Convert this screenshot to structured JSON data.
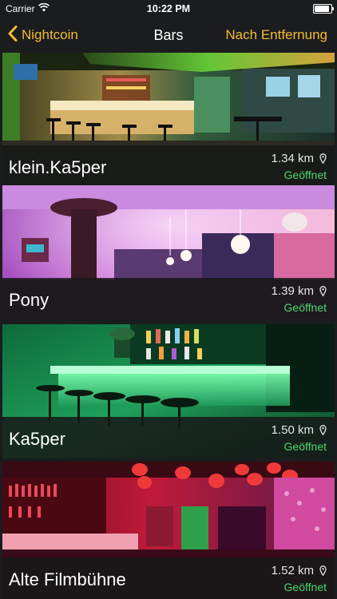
{
  "status": {
    "carrier": "Carrier",
    "time": "10:22 PM",
    "battery_level": 0.9
  },
  "nav": {
    "back_label": "Nightcoin",
    "title": "Bars",
    "sort_label": "Nach Entfernung"
  },
  "colors": {
    "accent": "#f2bd2f",
    "open_status": "#4cd96a",
    "background": "#1b1c1e"
  },
  "bars": [
    {
      "name": "klein.Ka5per",
      "distance": "1.34 km",
      "status": "Geöffnet"
    },
    {
      "name": "Pony",
      "distance": "1.39 km",
      "status": "Geöffnet"
    },
    {
      "name": "Ka5per",
      "distance": "1.50 km",
      "status": "Geöffnet"
    },
    {
      "name": "Alte Filmbühne",
      "distance": "1.52 km",
      "status": "Geöffnet"
    }
  ],
  "icons": {
    "back": "chevron-left-icon",
    "wifi": "wifi-icon",
    "battery": "battery-icon",
    "location": "location-pin-icon"
  }
}
